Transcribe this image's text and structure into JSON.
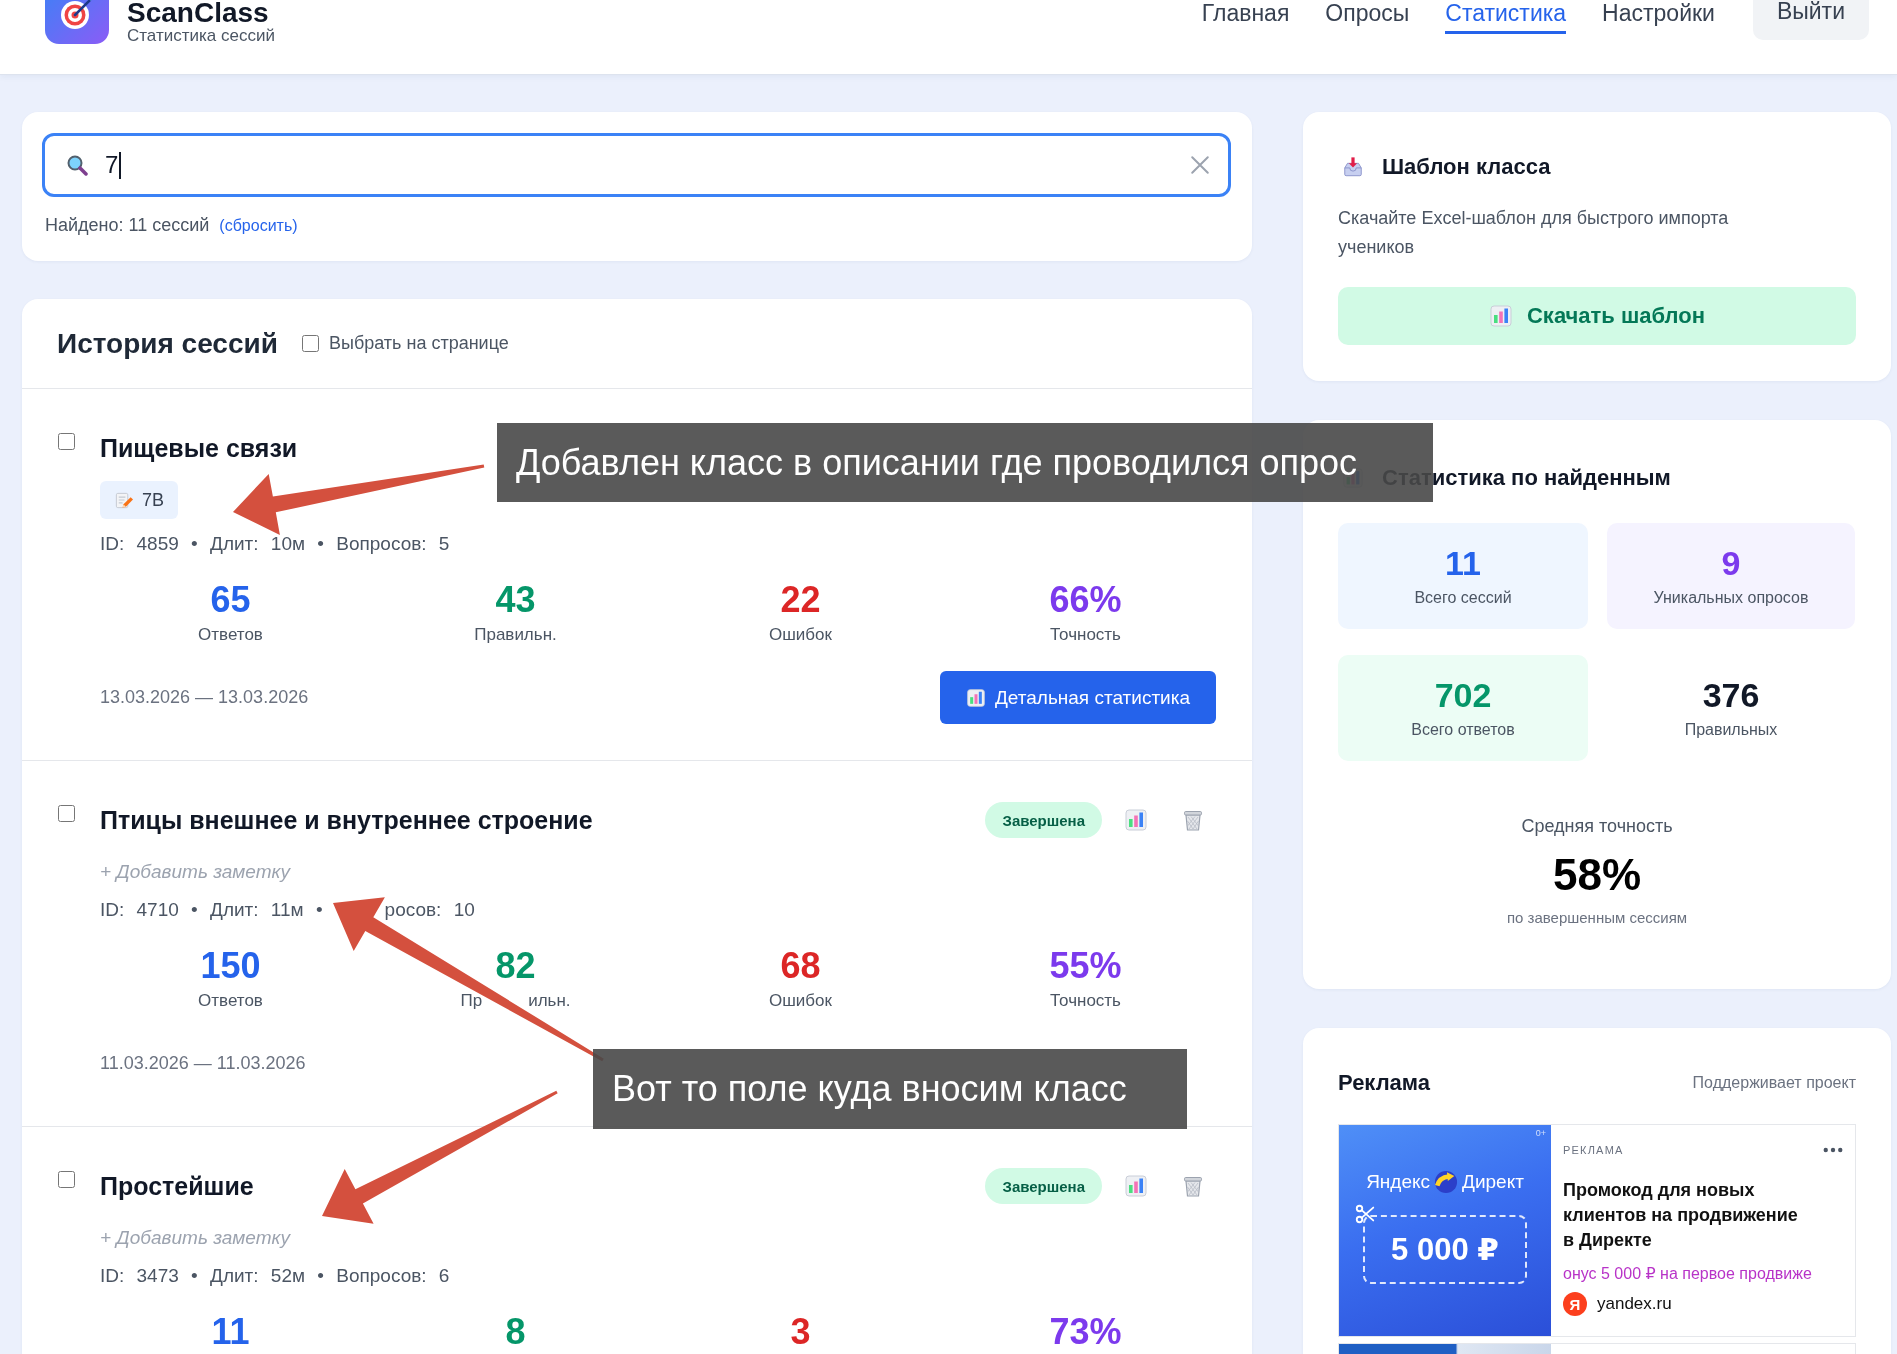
{
  "app": {
    "title": "ScanClass",
    "subtitle": "Статистика сессий"
  },
  "nav": [
    {
      "label": "Главная",
      "selected": false
    },
    {
      "label": "Опросы",
      "selected": false
    },
    {
      "label": "Статистика",
      "selected": true
    },
    {
      "label": "Настройки",
      "selected": false
    }
  ],
  "logout": "Выйти",
  "search": {
    "value": "7",
    "focused": true,
    "found": "Найдено: 11 сессий",
    "reset": "(сбросить)"
  },
  "history": {
    "title": "История сессий",
    "select_page": {
      "label": "Выбрать на странице",
      "checked": false
    }
  },
  "sessions": [
    {
      "title": "Пищевые связи",
      "checked": false,
      "note": {
        "kind": "tag",
        "text": "7В"
      },
      "meta": [
        "ID: 4859 • Длит: 10м • Вопросов: 5"
      ],
      "stats": [
        {
          "kind": "answers",
          "value": "65",
          "label": "Ответов"
        },
        {
          "kind": "correct",
          "value": "43",
          "label": "Правильн."
        },
        {
          "kind": "errors",
          "value": "22",
          "label": "Ошибок"
        },
        {
          "kind": "accuracy",
          "value": "66%",
          "label": "Точность"
        }
      ],
      "date": "13.03.2026 — 13.03.2026",
      "details_button": "Детальная статистика"
    },
    {
      "title": "Птицы внешнее и внутреннее строение",
      "checked": false,
      "status": "Завершена",
      "note": {
        "kind": "add",
        "text": "+ Добавить заметку"
      },
      "meta": [
        "ID: 4710 • Длит: 11м •",
        "росов: 10"
      ],
      "stats": [
        {
          "kind": "answers",
          "value": "150",
          "label": "Ответов"
        },
        {
          "kind": "correct",
          "value": "82",
          "label_parts": [
            "Пр",
            "ильн."
          ]
        },
        {
          "kind": "errors",
          "value": "68",
          "label": "Ошибок"
        },
        {
          "kind": "accuracy",
          "value": "55%",
          "label": "Точность"
        }
      ],
      "date": "11.03.2026 — 11.03.2026"
    },
    {
      "title": "Простейшие",
      "checked": false,
      "status": "Завершена",
      "note": {
        "kind": "add",
        "text": "+ Добавить заметку"
      },
      "meta": [
        "ID: 3473 • Длит: 52м • Вопросов: 6"
      ],
      "stats": [
        {
          "kind": "answers",
          "value": "11"
        },
        {
          "kind": "correct",
          "value": "8"
        },
        {
          "kind": "errors",
          "value": "3"
        },
        {
          "kind": "accuracy",
          "value": "73%"
        }
      ]
    }
  ],
  "template_card": {
    "title": "Шаблон класса",
    "description": "Скачайте Excel-шаблон для быстрого импорта учеников",
    "button": "Скачать шаблон"
  },
  "found_stats": {
    "title": "Статистика по найденным",
    "tiles": [
      {
        "kind": "sessions",
        "value": "11",
        "label": "Всего сессий"
      },
      {
        "kind": "surveys",
        "value": "9",
        "label": "Уникальных опросов"
      },
      {
        "kind": "answers",
        "value": "702",
        "label": "Всего ответов"
      },
      {
        "kind": "correct",
        "value": "376",
        "label": "Правильных"
      }
    ],
    "avg_label": "Средняя точность",
    "avg_value": "58%",
    "avg_note": "по завершенным сессиям"
  },
  "ad": {
    "title": "Реклама",
    "support": "Поддерживает проект",
    "banner": {
      "brand_left": "Яндекс",
      "brand_right": "Директ",
      "amount": "5 000 ₽",
      "age": "0+"
    },
    "label": "РЕКЛАМА",
    "headline": "Промокод для новых клиентов на продвижение в Директе",
    "promo": "онус 5 000 ₽ на первое продвиже",
    "logo_letter": "Я",
    "domain": "yandex.ru"
  },
  "callouts": [
    {
      "text": "Добавлен класс в описании где проводился опрос"
    },
    {
      "text": "Вот то поле куда вносим класс"
    }
  ]
}
